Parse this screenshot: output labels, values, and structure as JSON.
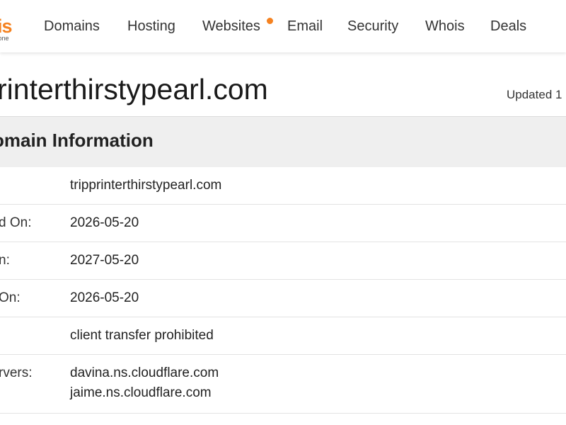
{
  "header": {
    "logo_text": "is",
    "logo_tagline": "yone",
    "nav": [
      {
        "label": "Domains"
      },
      {
        "label": "Hosting"
      },
      {
        "label": "Websites"
      },
      {
        "label": "Email"
      },
      {
        "label": "Security"
      },
      {
        "label": "Whois"
      },
      {
        "label": "Deals"
      }
    ],
    "accent_color": "#f58220"
  },
  "domain": {
    "title": "rinterthirstypearl.com",
    "updated": "Updated 1"
  },
  "section": {
    "title": "omain Information",
    "rows": [
      {
        "label": "",
        "value": "tripprinterthirstypearl.com"
      },
      {
        "label": "d On:",
        "value": "2026-05-20"
      },
      {
        "label": "n:",
        "value": "2027-05-20"
      },
      {
        "label": "On:",
        "value": "2026-05-20"
      },
      {
        "label": "",
        "value": "client transfer prohibited"
      },
      {
        "label": "rvers:",
        "values": [
          "davina.ns.cloudflare.com",
          "jaime.ns.cloudflare.com"
        ]
      }
    ]
  }
}
